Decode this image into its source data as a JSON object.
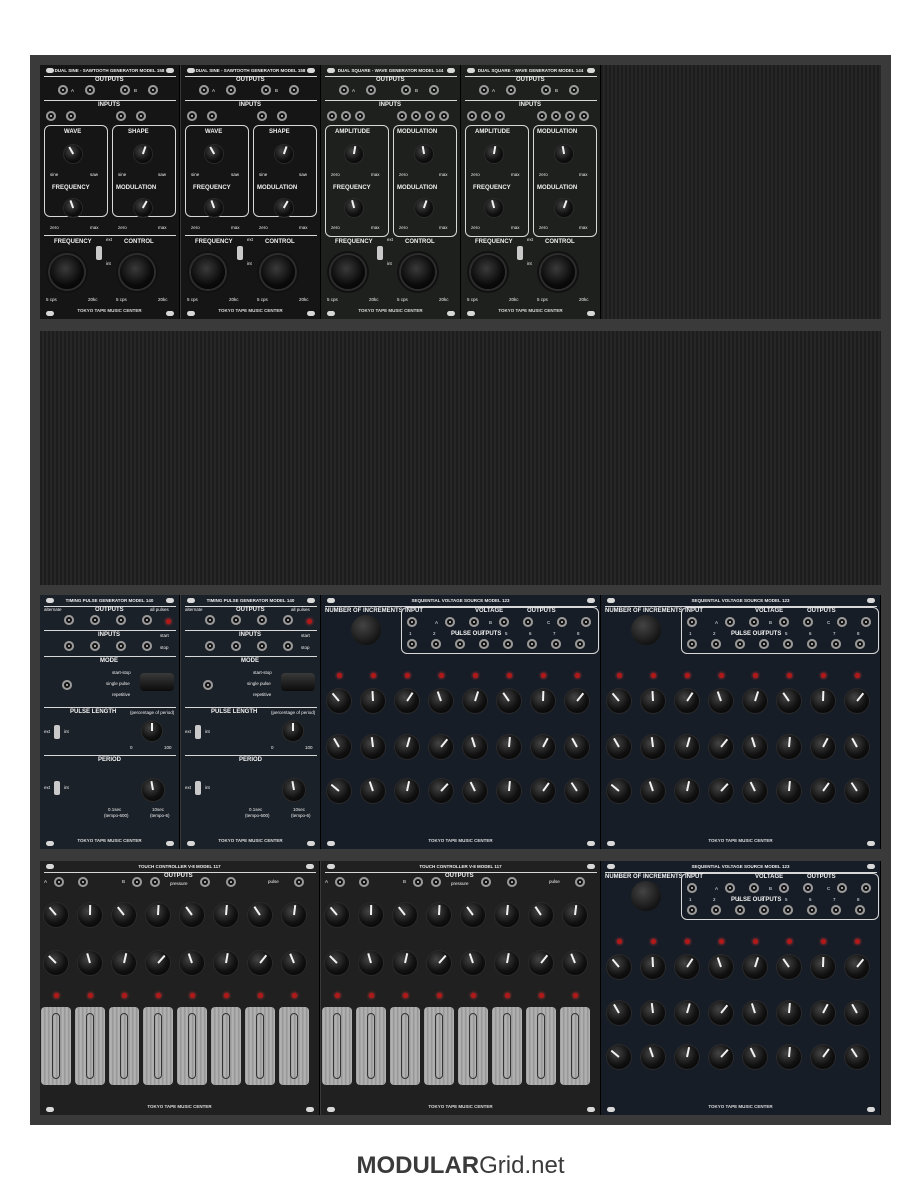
{
  "brand": {
    "bold": "MODULAR",
    "regular": "Grid.net"
  },
  "rows": {
    "row1": {
      "sine_saw_1": {
        "title": "DUAL SINE - SAWTOOTH GENERATOR MODEL 158",
        "outputs": "OUTPUTS",
        "a": "A",
        "b": "B",
        "inputs": "INPUTS",
        "wave": "WAVE",
        "shape": "SHAPE",
        "sine": "sine",
        "saw": "saw",
        "frequency": "FREQUENCY",
        "modulation": "MODULATION",
        "zero": "zero",
        "max": "max",
        "control": "CONTROL",
        "ext": "ext",
        "int": "int",
        "cps5": "5 cps",
        "kc20": "20kc",
        "footer": "TOKYO TAPE MUSIC CENTER"
      },
      "sine_saw_2": {
        "title": "DUAL SINE - SAWTOOTH GENERATOR MODEL 158",
        "outputs": "OUTPUTS",
        "a": "A",
        "b": "B",
        "inputs": "INPUTS",
        "wave": "WAVE",
        "shape": "SHAPE",
        "sine": "sine",
        "saw": "saw",
        "frequency": "FREQUENCY",
        "modulation": "MODULATION",
        "zero": "zero",
        "max": "max",
        "control": "CONTROL",
        "ext": "ext",
        "int": "int",
        "cps5": "5 cps",
        "kc20": "20kc",
        "footer": "TOKYO TAPE MUSIC CENTER"
      },
      "square_1": {
        "title": "DUAL SQUARE - WAVE GENERATOR MODEL 144",
        "outputs": "OUTPUTS",
        "a": "A",
        "b": "B",
        "inputs": "INPUTS",
        "amplitude": "AMPLITUDE",
        "modulation": "MODULATION",
        "frequency": "FREQUENCY",
        "control": "CONTROL",
        "zero": "zero",
        "max": "max",
        "ext": "ext",
        "int": "int",
        "cps5": "5 cps",
        "kc20": "20kc",
        "footer": "TOKYO TAPE MUSIC CENTER"
      },
      "square_2": {
        "title": "DUAL SQUARE - WAVE GENERATOR MODEL 144",
        "outputs": "OUTPUTS",
        "a": "A",
        "b": "B",
        "inputs": "INPUTS",
        "amplitude": "AMPLITUDE",
        "modulation": "MODULATION",
        "frequency": "FREQUENCY",
        "control": "CONTROL",
        "zero": "zero",
        "max": "max",
        "ext": "ext",
        "int": "int",
        "cps5": "5 cps",
        "kc20": "20kc",
        "footer": "TOKYO TAPE MUSIC CENTER"
      }
    },
    "row3": {
      "pulse_1": {
        "title": "TIMING PULSE GENERATOR   MODEL 140",
        "outputs": "OUTPUTS",
        "alternate": "alternate",
        "all_pulses": "all pulses",
        "inputs": "INPUTS",
        "start": "start",
        "stop": "stop",
        "mode": "MODE",
        "start_stop": "start-stop",
        "single_pulse": "single pulse",
        "repetitive": "repetitive",
        "pulse_length": "PULSE LENGTH",
        "pct": "(percentage of period)",
        "ext": "ext",
        "int": "int",
        "zero": "0",
        "hundred": "100",
        "period": "PERIOD",
        "sec_short": "0.1sec",
        "tempo_short": "(tempo-600)",
        "sec_long": "10sec",
        "tempo_long": "(tempo-6)",
        "footer": "TOKYO TAPE MUSIC CENTER"
      },
      "pulse_2": {
        "title": "TIMING PULSE GENERATOR   MODEL 140",
        "outputs": "OUTPUTS",
        "alternate": "alternate",
        "all_pulses": "all pulses",
        "inputs": "INPUTS",
        "start": "start",
        "stop": "stop",
        "mode": "MODE",
        "start_stop": "start-stop",
        "single_pulse": "single pulse",
        "repetitive": "repetitive",
        "pulse_length": "PULSE LENGTH",
        "pct": "(percentage of period)",
        "ext": "ext",
        "int": "int",
        "zero": "0",
        "hundred": "100",
        "period": "PERIOD",
        "sec_short": "0.1sec",
        "tempo_short": "(tempo-600)",
        "sec_long": "10sec",
        "tempo_long": "(tempo-6)",
        "footer": "TOKYO TAPE MUSIC CENTER"
      },
      "seq_1": {
        "title": "SEQUENTIAL VOLTAGE SOURCE MODEL 123",
        "increments": "NUMBER OF INCREMENTS",
        "input": "INPUT",
        "voltage": "VOLTAGE",
        "outputs": "OUTPUTS",
        "a": "A",
        "b": "B",
        "c": "C",
        "pulse_outputs": "PULSE OUTPUTS",
        "steps": [
          "1",
          "2",
          "3",
          "4",
          "5",
          "6",
          "7",
          "8"
        ],
        "footer": "TOKYO TAPE MUSIC CENTER"
      },
      "seq_2": {
        "title": "SEQUENTIAL VOLTAGE SOURCE MODEL 123",
        "increments": "NUMBER OF INCREMENTS",
        "input": "INPUT",
        "voltage": "VOLTAGE",
        "outputs": "OUTPUTS",
        "a": "A",
        "b": "B",
        "c": "C",
        "pulse_outputs": "PULSE OUTPUTS",
        "steps": [
          "1",
          "2",
          "3",
          "4",
          "5",
          "6",
          "7",
          "8"
        ],
        "footer": "TOKYO TAPE MUSIC CENTER"
      }
    },
    "row4": {
      "touch_1": {
        "title": "TOUCH CONTROLLER V-8   MODEL 117",
        "outputs": "OUTPUTS",
        "a": "A",
        "b": "B",
        "pressure": "pressure",
        "pulse": "pulse",
        "footer": "TOKYO TAPE MUSIC CENTER"
      },
      "touch_2": {
        "title": "TOUCH CONTROLLER V-8   MODEL 117",
        "outputs": "OUTPUTS",
        "a": "A",
        "b": "B",
        "pressure": "pressure",
        "pulse": "pulse",
        "footer": "TOKYO TAPE MUSIC CENTER"
      },
      "seq_3": {
        "title": "SEQUENTIAL VOLTAGE SOURCE MODEL 123",
        "increments": "NUMBER OF INCREMENTS",
        "input": "INPUT",
        "voltage": "VOLTAGE",
        "outputs": "OUTPUTS",
        "a": "A",
        "b": "B",
        "c": "C",
        "pulse_outputs": "PULSE OUTPUTS",
        "steps": [
          "1",
          "2",
          "3",
          "4",
          "5",
          "6",
          "7",
          "8"
        ],
        "footer": "TOKYO TAPE MUSIC CENTER"
      }
    }
  }
}
